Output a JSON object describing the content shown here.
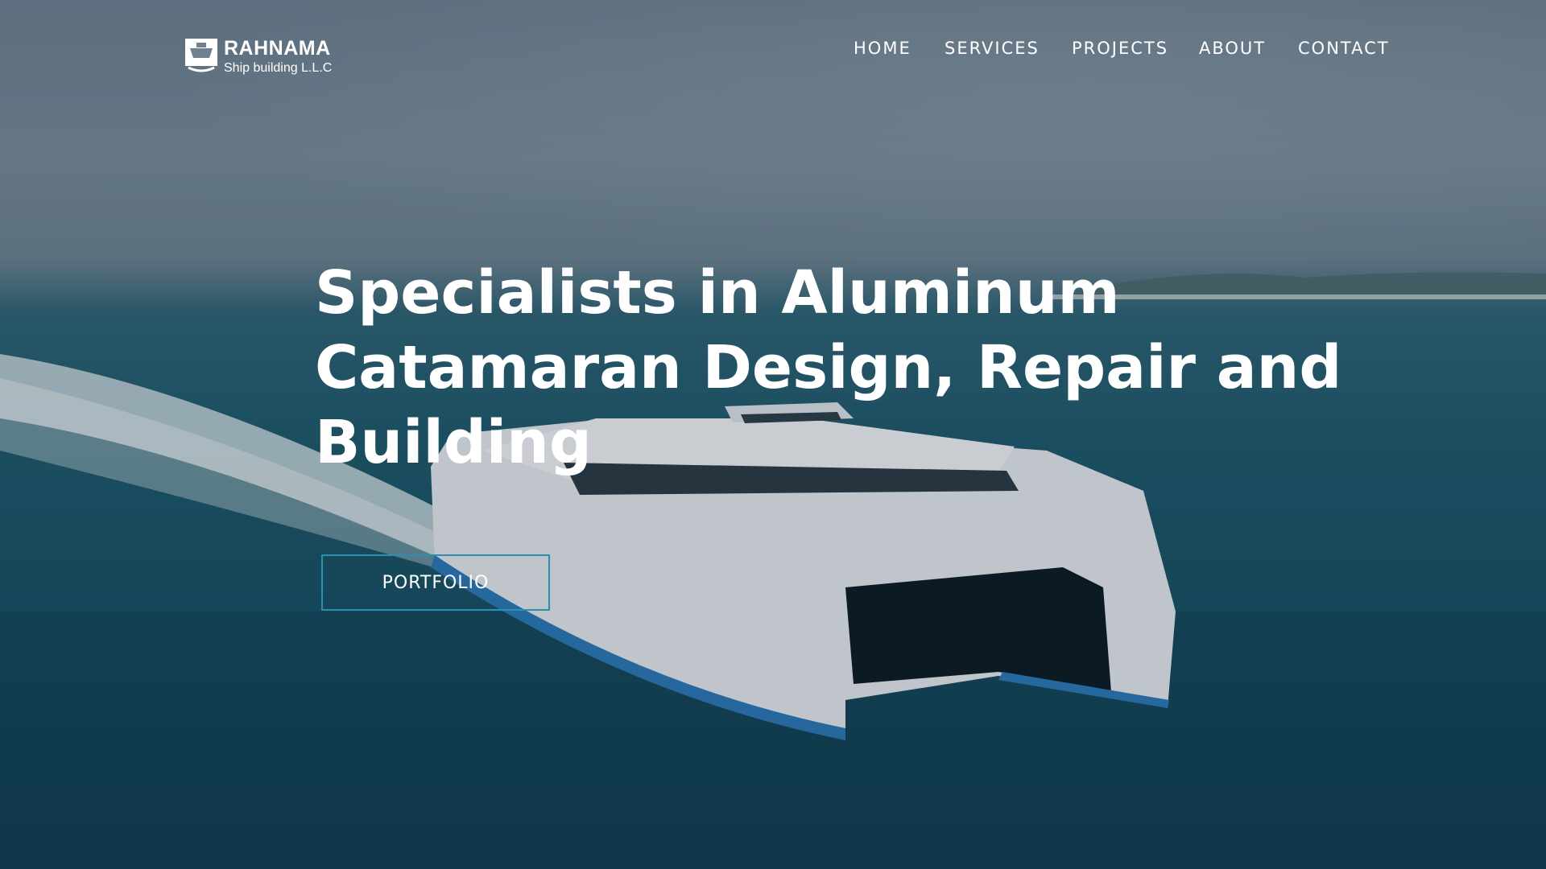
{
  "brand": {
    "name": "RAHNAMA",
    "subtitle": "Ship building L.L.C",
    "logo_icon": "ship-emblem-icon"
  },
  "nav": {
    "items": [
      {
        "label": "HOME"
      },
      {
        "label": "SERVICES"
      },
      {
        "label": "PROJECTS"
      },
      {
        "label": "ABOUT"
      },
      {
        "label": "CONTACT"
      }
    ]
  },
  "hero": {
    "headline_lines": [
      "Specialists in Aluminum",
      "Catamaran Design, Repair and",
      "Building"
    ],
    "cta_label": "PORTFOLIO"
  },
  "colors": {
    "accent": "#2a8fb0",
    "text": "#ffffff",
    "sea": "#1f5a6c"
  }
}
